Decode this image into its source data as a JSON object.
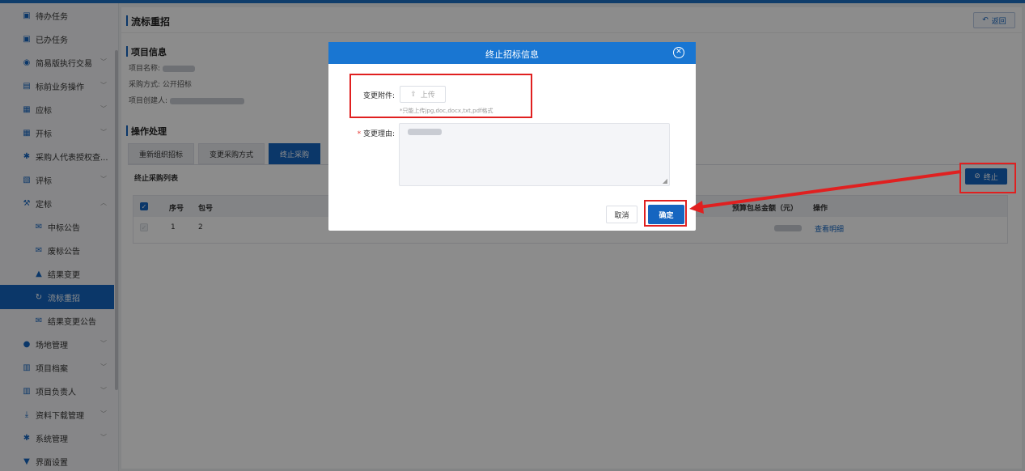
{
  "sidebar": {
    "items": [
      {
        "label": "待办任务",
        "icon": "todo-icon",
        "chevron": false
      },
      {
        "label": "已办任务",
        "icon": "done-icon",
        "chevron": false
      },
      {
        "label": "简易版执行交易",
        "icon": "play-circle-icon",
        "chevron": true
      },
      {
        "label": "标前业务操作",
        "icon": "cart-icon",
        "chevron": true
      },
      {
        "label": "应标",
        "icon": "doc-icon",
        "chevron": true
      },
      {
        "label": "开标",
        "icon": "doc-icon",
        "chevron": true
      },
      {
        "label": "采购人代表授权查...",
        "icon": "gear-icon",
        "chevron": false
      },
      {
        "label": "评标",
        "icon": "chart-icon",
        "chevron": true
      },
      {
        "label": "定标",
        "icon": "gavel-icon",
        "chevron": true
      },
      {
        "label": "中标公告",
        "icon": "mail-icon",
        "sub": true
      },
      {
        "label": "废标公告",
        "icon": "mail-icon",
        "sub": true
      },
      {
        "label": "结果变更",
        "icon": "lock-icon",
        "sub": true
      },
      {
        "label": "流标重招",
        "icon": "refresh-icon",
        "sub": true,
        "active": true
      },
      {
        "label": "结果变更公告",
        "icon": "mail-icon",
        "sub": true
      },
      {
        "label": "场地管理",
        "icon": "user-icon",
        "chevron": true
      },
      {
        "label": "项目档案",
        "icon": "folder-icon",
        "chevron": true
      },
      {
        "label": "项目负责人",
        "icon": "folder-icon",
        "chevron": true
      },
      {
        "label": "资料下载管理",
        "icon": "download-icon",
        "chevron": true
      },
      {
        "label": "系统管理",
        "icon": "gear-icon",
        "chevron": true
      },
      {
        "label": "界面设置",
        "icon": "shirt-icon",
        "chevron": false
      }
    ]
  },
  "page": {
    "title": "流标重招",
    "back_label": "返回",
    "project_info_title": "项目信息",
    "project_name_label": "项目名称:",
    "purchase_method_label": "采购方式:",
    "purchase_method_value": "公开招标",
    "creator_label": "项目创建人:",
    "operation_title": "操作处理",
    "tabs": [
      "重新组织招标",
      "变更采购方式",
      "终止采购"
    ],
    "list_label": "终止采购列表",
    "stop_button": "终止"
  },
  "table": {
    "headers": [
      "序号",
      "包号",
      "预算包总金额（元）",
      "操作"
    ],
    "rows": [
      {
        "index": "1",
        "package": "2",
        "action": "查看明细"
      }
    ]
  },
  "dialog": {
    "title": "终止招标信息",
    "attachment_label": "变更附件:",
    "upload_label": "上传",
    "upload_hint": "*只能上传jpg,doc,docx,txt,pdf格式",
    "reason_label": "变更理由:",
    "cancel_label": "取消",
    "confirm_label": "确定"
  },
  "colors": {
    "accent": "#1565c0",
    "highlight": "#e02020"
  }
}
